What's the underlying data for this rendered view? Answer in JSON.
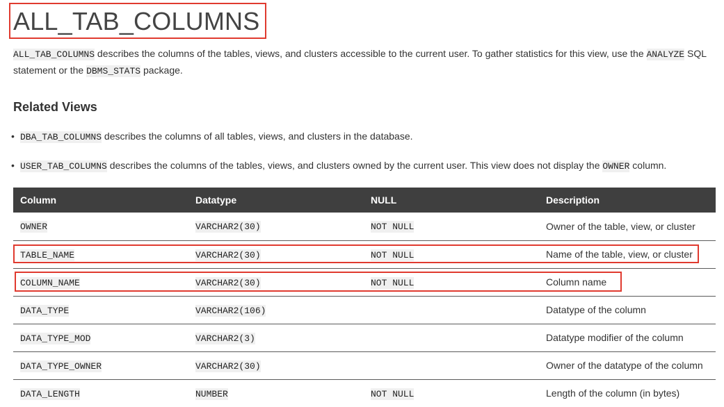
{
  "page_title": "ALL_TAB_COLUMNS",
  "intro": {
    "code_view": "ALL_TAB_COLUMNS",
    "text_1": " describes the columns of the tables, views, and clusters accessible to the current user. To gather statistics for this view, use the ",
    "code_analyze": "ANALYZE",
    "text_2": " SQL statement or the ",
    "code_dbms": "DBMS_STATS",
    "text_3": " package."
  },
  "related_views": {
    "title": "Related Views",
    "items": [
      {
        "code": "DBA_TAB_COLUMNS",
        "text": " describes the columns of all tables, views, and clusters in the database."
      },
      {
        "code": "USER_TAB_COLUMNS",
        "text": " describes the columns of the tables, views, and clusters owned by the current user. This view does not display the ",
        "code2": "OWNER",
        "text2": " column."
      }
    ]
  },
  "table": {
    "headers": [
      "Column",
      "Datatype",
      "NULL",
      "Description"
    ],
    "rows": [
      {
        "column": "OWNER",
        "datatype": "VARCHAR2(30)",
        "null": "NOT NULL",
        "description": "Owner of the table, view, or cluster"
      },
      {
        "column": "TABLE_NAME",
        "datatype": "VARCHAR2(30)",
        "null": "NOT NULL",
        "description": "Name of the table, view, or cluster"
      },
      {
        "column": "COLUMN_NAME",
        "datatype": "VARCHAR2(30)",
        "null": "NOT NULL",
        "description": "Column name"
      },
      {
        "column": "DATA_TYPE",
        "datatype": "VARCHAR2(106)",
        "null": "",
        "description": "Datatype of the column"
      },
      {
        "column": "DATA_TYPE_MOD",
        "datatype": "VARCHAR2(3)",
        "null": "",
        "description": "Datatype modifier of the column"
      },
      {
        "column": "DATA_TYPE_OWNER",
        "datatype": "VARCHAR2(30)",
        "null": "",
        "description": "Owner of the datatype of the column"
      },
      {
        "column": "DATA_LENGTH",
        "datatype": "NUMBER",
        "null": "NOT NULL",
        "description": "Length of the column (in bytes)"
      }
    ]
  },
  "colors": {
    "highlight_border": "#e03a2f",
    "table_header_bg": "#3f3f3f",
    "code_bg": "#f0f0f0"
  }
}
